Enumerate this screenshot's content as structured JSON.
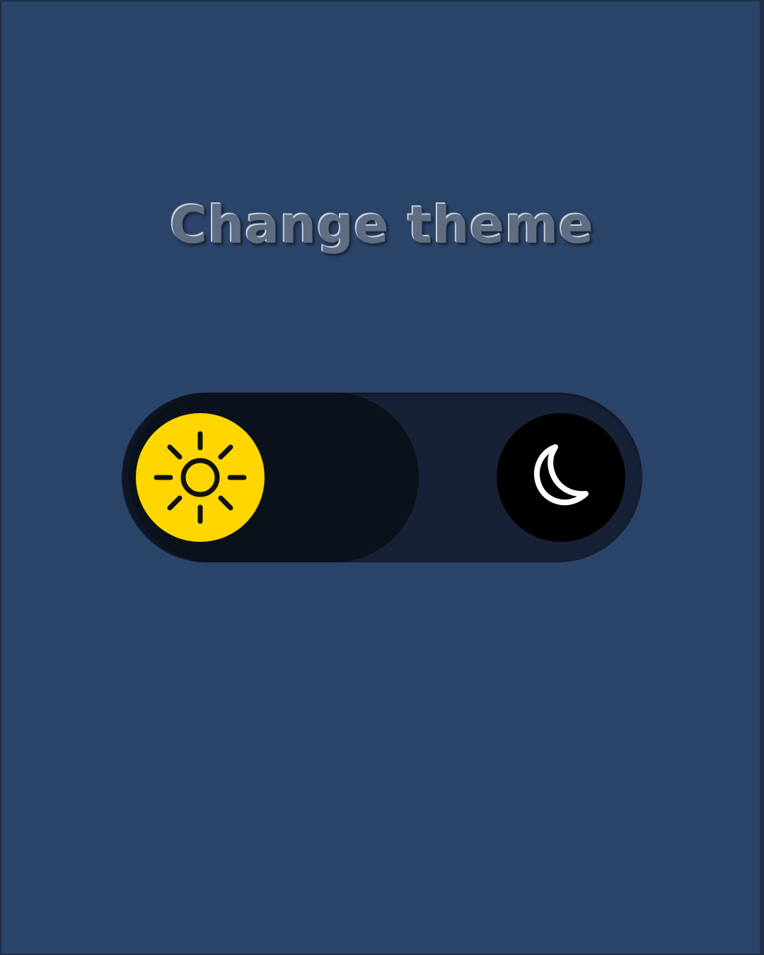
{
  "heading": {
    "title": "Change theme"
  },
  "theme_toggle": {
    "options": [
      "light",
      "dark"
    ],
    "selected": "light",
    "light_icon": "sun-icon",
    "dark_icon": "moon-icon",
    "colors": {
      "background": "#2a446a",
      "track": "#172136",
      "track_fill": "#0b111b",
      "sun_knob": "#ffd600",
      "moon_knob": "#000000",
      "moon_stroke": "#ffffff",
      "sun_stroke": "#111111"
    }
  }
}
